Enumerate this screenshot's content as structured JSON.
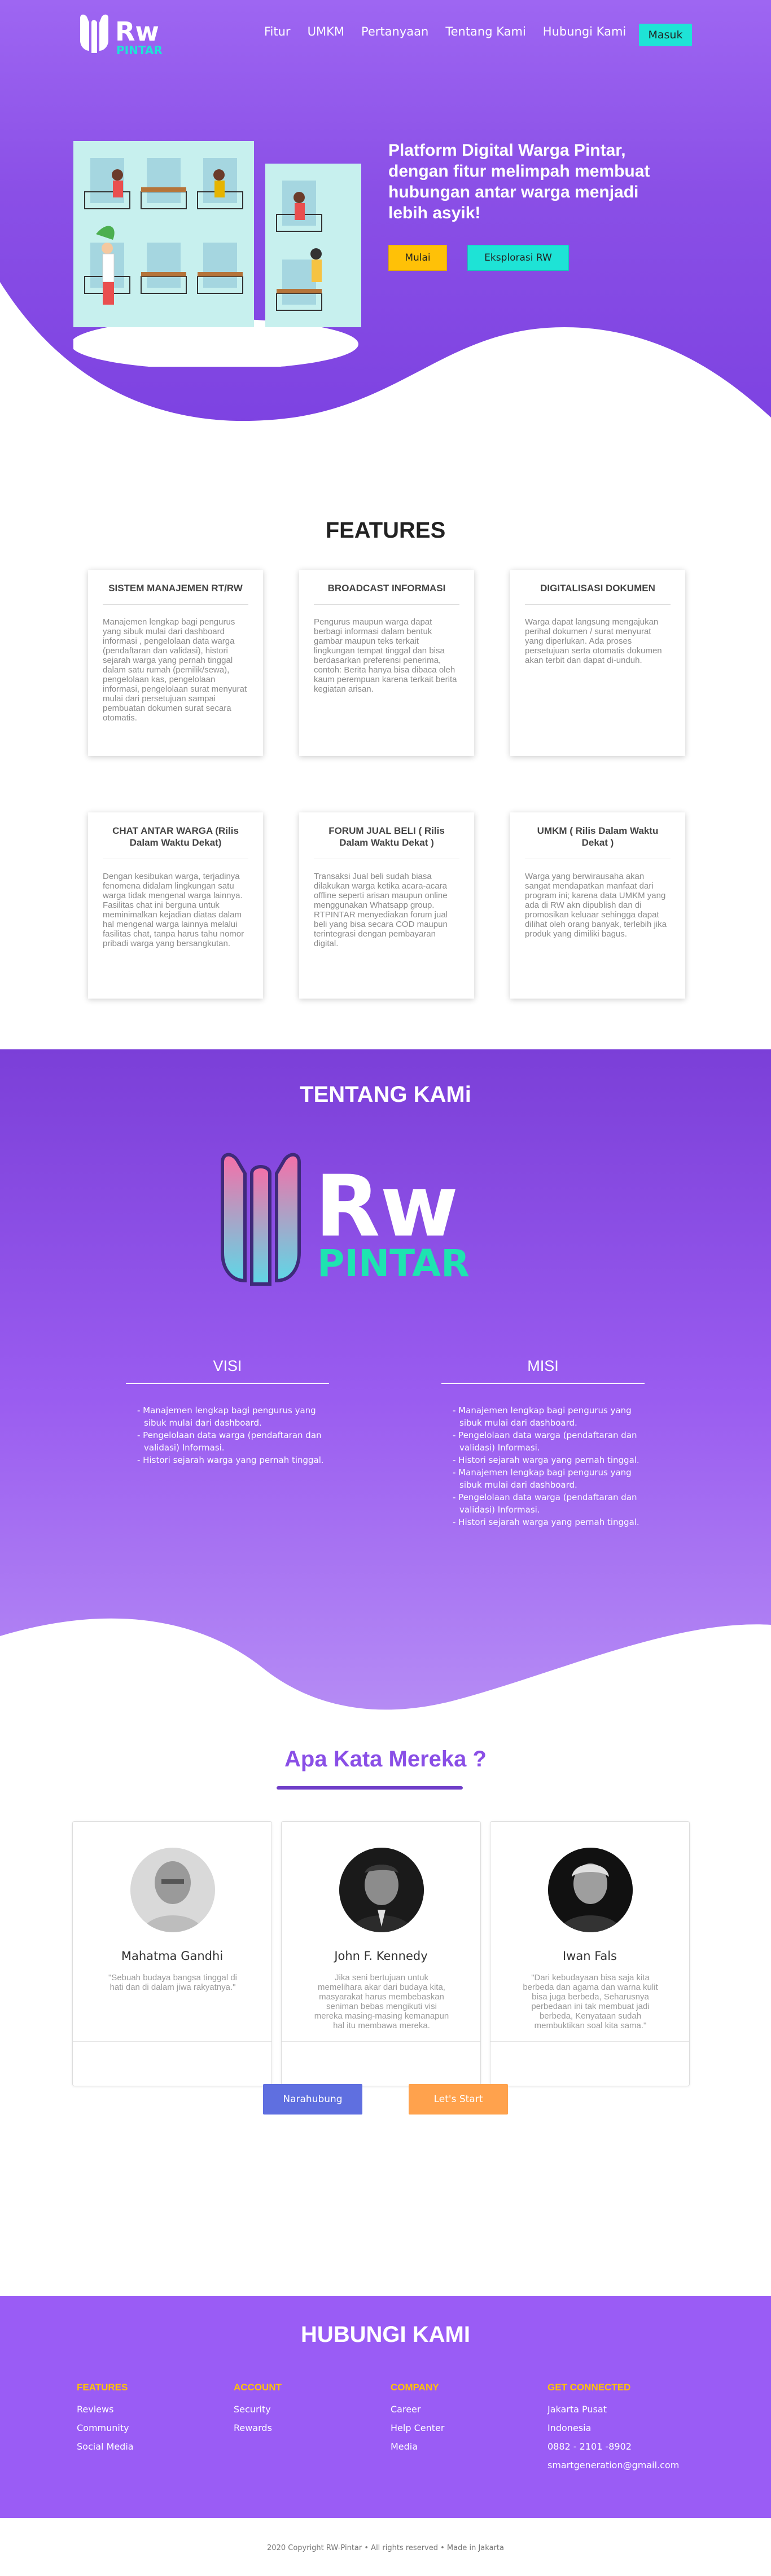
{
  "nav": {
    "logo_rw": "Rw",
    "logo_pintar": "PINTAR",
    "links": [
      "Fitur",
      "UMKM",
      "Pertanyaan",
      "Tentang Kami",
      "Hubungi Kami"
    ],
    "login_label": "Masuk"
  },
  "hero": {
    "headline": "Platform Digital Warga Pintar, dengan fitur melimpah membuat hubungan antar warga menjadi lebih asyik!",
    "start_label": "Mulai",
    "explore_label": "Eksplorasi RW"
  },
  "features": {
    "title": "FEATURES",
    "items": [
      {
        "title": "SISTEM MANAJEMEN RT/RW",
        "desc": "Manajemen lengkap bagi pengurus yang sibuk mulai dari dashboard informasi , pengelolaan data warga (pendaftaran dan validasi), histori sejarah warga yang pernah tinggal dalam satu rumah (pemilik/sewa), pengelolaan kas, pengelolaan informasi, pengelolaan surat menyurat mulai dari persetujuan sampai pembuatan dokumen surat secara otomatis."
      },
      {
        "title": "BROADCAST INFORMASI",
        "desc": "Pengurus maupun warga dapat berbagi informasi dalam bentuk gambar maupun teks terkait lingkungan tempat tinggal dan bisa berdasarkan preferensi penerima, contoh: Berita hanya bisa dibaca oleh kaum perempuan karena terkait berita kegiatan arisan."
      },
      {
        "title": "DIGITALISASI DOKUMEN",
        "desc": "Warga dapat langsung mengajukan perihal dokumen / surat menyurat yang diperlukan. Ada proses persetujuan serta otomatis dokumen akan terbit dan dapat di-unduh."
      },
      {
        "title": "CHAT ANTAR WARGA (Rilis Dalam Waktu Dekat)",
        "desc": "Dengan kesibukan warga, terjadinya fenomena didalam lingkungan satu warga tidak mengenal warga lainnya. Fasilitas chat ini berguna untuk meminimalkan kejadian diatas dalam hal mengenal warga lainnya melalui fasilitas chat, tanpa harus tahu nomor pribadi warga yang bersangkutan."
      },
      {
        "title": "FORUM JUAL BELI ( Rilis Dalam Waktu Dekat )",
        "desc": "Transaksi Jual beli sudah biasa dilakukan warga ketika acara-acara offline seperti arisan maupun online menggunakan Whatsapp group. RTPINTAR menyediakan forum jual beli yang bisa secara COD maupun terintegrasi dengan pembayaran digital."
      },
      {
        "title": "UMKM ( Rilis Dalam Waktu Dekat )",
        "desc": "Warga yang berwirausaha akan sangat mendapatkan manfaat dari program ini; karena data UMKM yang ada di RW akn dipublish dan di promosikan keluaar sehingga dapat dilihat oleh orang banyak, terlebih jika produk yang dimiliki bagus."
      }
    ]
  },
  "about": {
    "title": "TENTANG KAMi",
    "logo_rw": "Rw",
    "logo_pintar": "PINTAR",
    "visi_title": "VISI",
    "visi_items": [
      "- Manajemen lengkap bagi pengurus yang sibuk mulai dari dashboard.",
      "- Pengelolaan data warga (pendaftaran dan validasi) Informasi.",
      "- Histori sejarah warga yang pernah tinggal."
    ],
    "misi_title": "MISI",
    "misi_items": [
      "- Manajemen lengkap bagi pengurus yang sibuk mulai dari dashboard.",
      "- Pengelolaan data warga (pendaftaran dan validasi) Informasi.",
      "- Histori sejarah warga yang pernah tinggal.",
      "- Manajemen lengkap bagi pengurus yang sibuk mulai dari dashboard.",
      "- Pengelolaan data warga (pendaftaran dan validasi) Informasi.",
      "- Histori sejarah warga yang pernah tinggal."
    ]
  },
  "testimonials": {
    "title": "Apa Kata Mereka ?",
    "items": [
      {
        "name": "Mahatma Gandhi",
        "quote": "\"Sebuah budaya bangsa tinggal di hati dan di dalam jiwa rakyatnya.\""
      },
      {
        "name": "John F. Kennedy",
        "quote": "Jika seni bertujuan untuk memelihara akar dari budaya kita, masyarakat harus membebaskan seniman bebas mengikuti visi mereka masing-masing kemanapun hal itu membawa mereka."
      },
      {
        "name": "Iwan Fals",
        "quote": "\"Dari kebudayaan bisa saja kita berbeda dan agama dan warna kulit bisa juga berbeda, Seharusnya perbedaan ini tak membuat jadi berbeda, Kenyataan sudah membuktikan soal kita sama.\""
      }
    ],
    "contact_label": "Narahubung",
    "start_label": "Let's Start"
  },
  "contact": {
    "title": "HUBUNGI KAMI",
    "columns": [
      {
        "heading": "FEATURES",
        "items": [
          "Reviews",
          "Community",
          "Social Media"
        ]
      },
      {
        "heading": "ACCOUNT",
        "items": [
          "Security",
          "Rewards"
        ]
      },
      {
        "heading": "COMPANY",
        "items": [
          "Career",
          "Help Center",
          "Media"
        ]
      },
      {
        "heading": "GET CONNECTED",
        "items": [
          "Jakarta Pusat",
          "Indonesia",
          "0882 - 2101 -8902",
          "smartgeneration@gmail.com"
        ]
      }
    ]
  },
  "footer": {
    "copyright": "2020 Copyright RW-Pintar • All rights reserved • Made in Jakarta"
  },
  "colors": {
    "primary_purple": "#8a4fe6",
    "cyan": "#1ee3d6",
    "yellow": "#ffc107",
    "orange": "#ffa24d",
    "blue_button": "#5f6fe0"
  }
}
